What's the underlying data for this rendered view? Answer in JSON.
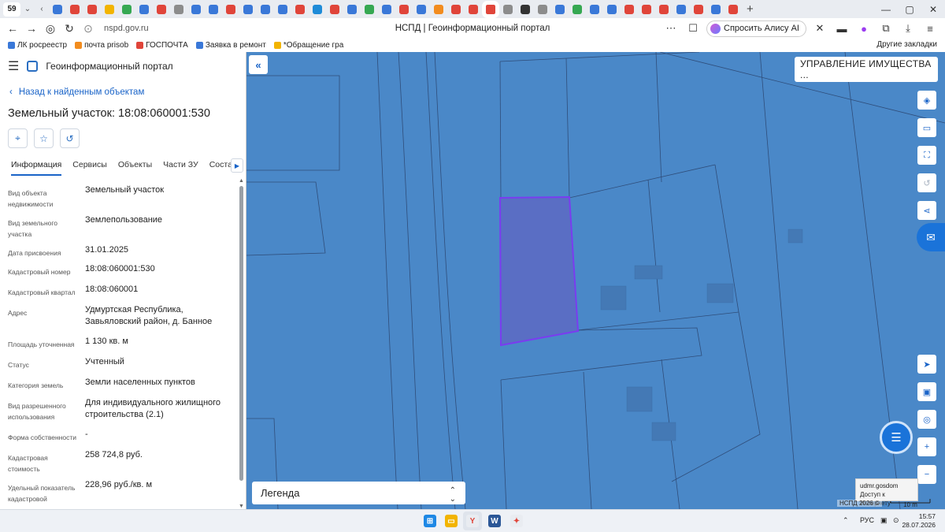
{
  "browser": {
    "tab_count": "59",
    "tab_favicons": [
      "#3a78d8",
      "#e0453a",
      "#e0453a",
      "#f2b400",
      "#36a852",
      "#3a78d8",
      "#e0453a",
      "#8c8c8c",
      "#3a78d8",
      "#3a78d8",
      "#e0453a",
      "#3a78d8",
      "#3a78d8",
      "#3a78d8",
      "#e0453a",
      "#1e8bd8",
      "#e0453a",
      "#3a78d8",
      "#36a852",
      "#3a78d8",
      "#e0453a",
      "#3a78d8",
      "#f28c1e",
      "#e0453a",
      "#e0453a",
      "#e0453a",
      "#8c8c8c",
      "#333333",
      "#8c8c8c",
      "#3a78d8",
      "#36a852",
      "#3a78d8",
      "#3a78d8",
      "#e0453a",
      "#e0453a",
      "#e0453a",
      "#3a78d8",
      "#e0453a",
      "#3a78d8",
      "#e0453a"
    ],
    "url": "nspd.gov.ru",
    "page_title": "НСПД | Геоинформационный портал",
    "alice_label": "Спросить Алису AI",
    "bookmarks": [
      {
        "label": "ЛК росреестр",
        "color": "#3a78d8"
      },
      {
        "label": "почта prisob",
        "color": "#f28c1e"
      },
      {
        "label": "ГОСПОЧТА",
        "color": "#e0453a"
      },
      {
        "label": "Заявка в ремонт",
        "color": "#3a78d8"
      },
      {
        "label": "*Обращение гра",
        "color": "#f2b400"
      }
    ],
    "other_bookmarks": "Другие закладки"
  },
  "sidebar": {
    "app_title": "Геоинформационный портал",
    "back_link": "Назад к найденным объектам",
    "object_title": "Земельный участок: 18:08:060001:530",
    "tabs": [
      {
        "label": "Информация",
        "active": true
      },
      {
        "label": "Сервисы"
      },
      {
        "label": "Объекты"
      },
      {
        "label": "Части ЗУ"
      },
      {
        "label": "Состав"
      }
    ],
    "properties": [
      {
        "label": "Вид объекта недвижимости",
        "value": "Земельный участок"
      },
      {
        "label": "Вид земельного участка",
        "value": "Землепользование"
      },
      {
        "label": "Дата присвоения",
        "value": "31.01.2025"
      },
      {
        "label": "Кадастровый номер",
        "value": "18:08:060001:530"
      },
      {
        "label": "Кадастровый квартал",
        "value": "18:08:060001"
      },
      {
        "label": "Адрес",
        "value": "Удмуртская Республика, Завьяловский район, д. Банное"
      },
      {
        "label": "Площадь уточненная",
        "value": "1 130 кв. м"
      },
      {
        "label": "Статус",
        "value": "Учтенный"
      },
      {
        "label": "Категория земель",
        "value": "Земли населенных пунктов"
      },
      {
        "label": "Вид разрешенного использования",
        "value": "Для индивидуального жилищного строительства (2.1)"
      },
      {
        "label": "Форма собственности",
        "value": "-"
      },
      {
        "label": "Кадастровая стоимость",
        "value": "258 724,8 руб."
      },
      {
        "label": "Удельный показатель кадастровой",
        "value": "228,96 руб./кв. м"
      }
    ]
  },
  "map": {
    "layer_select": "УПРАВЛЕНИЕ ИМУЩЕСТВА ...",
    "legend_label": "Легенда",
    "tooltip_line1": "udmr.gosdom",
    "tooltip_line2": "Доступ к Интернету",
    "attribution": "НСПД 2026 ©",
    "scale_label": "10 m",
    "colors": {
      "base": "#4a88c8",
      "parcel_fill": "#5a6ec4",
      "parcel_stroke": "#7a3cf0",
      "line": "#2f4d7a"
    }
  },
  "taskbar": {
    "lang": "РУС",
    "time": "15:57",
    "date": "28.07.2026"
  }
}
